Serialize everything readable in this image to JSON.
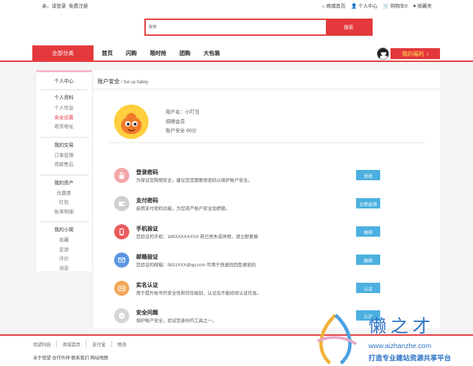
{
  "topbar": {
    "left": [
      "亲，请登录",
      "免费注册"
    ],
    "right": [
      {
        "icon": "home-icon",
        "label": "商城首页"
      },
      {
        "icon": "user-icon",
        "label": "个人中心"
      },
      {
        "icon": "cart-icon",
        "label": "购物车0"
      },
      {
        "icon": "heart-icon",
        "label": "收藏夹"
      }
    ]
  },
  "search": {
    "placeholder": "搜索",
    "button": "搜索"
  },
  "nav": {
    "category": "全部分类",
    "links": [
      "首页",
      "闪购",
      "限时抢",
      "团购",
      "大包装"
    ],
    "welfare": "我的福利"
  },
  "sidebar": {
    "title": "个人中心",
    "groups": [
      {
        "heading": "个人资料",
        "items": [
          "个人信息",
          "安全设置",
          "收货地址"
        ],
        "active": 1
      },
      {
        "heading": "我的交易",
        "items": [
          "订单管理",
          "退款售后"
        ]
      },
      {
        "heading": "我的资产",
        "items": [
          "优惠券",
          "红包",
          "账单明细"
        ]
      },
      {
        "heading": "我的小窝",
        "items": [
          "收藏",
          "足迹",
          "评价",
          "消息"
        ]
      }
    ]
  },
  "main": {
    "title": "账户安全",
    "subtitle": "/ Set up Safety",
    "profile": {
      "username": "用户名：小叮当",
      "level": "铜牌会员",
      "score": "账户安全 60分"
    },
    "items": [
      {
        "icon": "lock-icon",
        "color": "#f0888a",
        "title": "登录密码",
        "desc": "为保证您购物安全，建议您定期更改密码以保护账户安全。",
        "button": "修改"
      },
      {
        "icon": "wallet-icon",
        "color": "#b8b8b8",
        "title": "支付密码",
        "desc": "启用支付密码功能，为您资产账户安全加把锁。",
        "button": "立即启用"
      },
      {
        "icon": "phone-icon",
        "color": "#e4393c",
        "title": "手机验证",
        "desc": "您验证的手机：186XXXXXXXX 若已丢失或停用，请立即更换",
        "button": "换绑"
      },
      {
        "icon": "mail-icon",
        "color": "#4a8fe0",
        "title": "邮箱验证",
        "desc": "您验证的邮箱：5831XXX@qq.com 可用于快速找回登录密码",
        "button": "换绑"
      },
      {
        "icon": "id-card-icon",
        "color": "#f0a04b",
        "title": "实名认证",
        "desc": "用于提升账号的安全性和信任级别，认证后不能修改认证信息。",
        "button": "认证"
      },
      {
        "icon": "shield-icon",
        "color": "#c8c8c8",
        "title": "安全问题",
        "desc": "保护账户安全，验证您身份的工具之一。",
        "button": "认证"
      }
    ]
  },
  "footer": {
    "links": [
      "恒望科技",
      "商城首页",
      "支付宝",
      "物流"
    ],
    "bottom": "关于恒望 合作伙伴 联系我们 网站地图"
  },
  "watermark": {
    "big": "懒之才",
    "url": "www.aizhanzhe.com",
    "slogan": "打造专业建站资源共享平台"
  }
}
